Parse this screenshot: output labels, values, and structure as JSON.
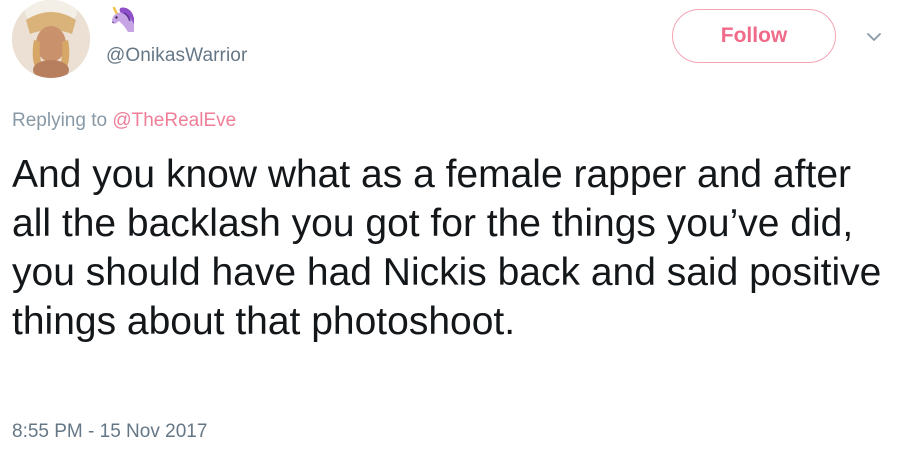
{
  "tweet": {
    "avatar_icon": "profile-photo",
    "display_name_emoji": "unicorn-icon",
    "handle": "@OnikasWarrior",
    "follow_label": "Follow",
    "reply_prefix": "Replying to ",
    "reply_mention": "@TheRealEve",
    "text": "And you know what as a female rapper and after all the backlash you got for the things you’ve did, you should have had Nickis back and said positive things about that photoshoot.",
    "timestamp": "8:55 PM - 15 Nov 2017",
    "menu_icon": "chevron-down-icon"
  },
  "colors": {
    "accent_pink": "#f06a8a",
    "follow_border": "#f4a5b5",
    "text_primary": "#14171a",
    "text_secondary": "#657786"
  }
}
